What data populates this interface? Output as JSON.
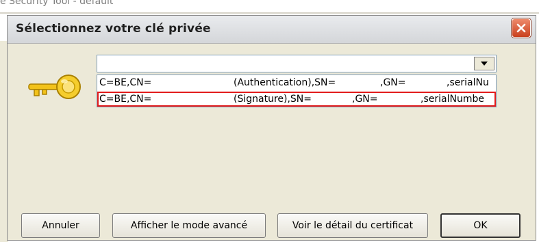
{
  "background": {
    "partial_title": "e Security Tool - default"
  },
  "dialog": {
    "title": "Sélectionnez votre clé privée",
    "close_symbol": "✕",
    "key_icon": "key-icon",
    "combo": {
      "selected_value": ""
    },
    "list_items": [
      {
        "segments": [
          "C=BE,CN=",
          "(Authentication),SN=",
          ",GN=",
          ",serialNu"
        ],
        "selected": false
      },
      {
        "segments": [
          "C=BE,CN=",
          "(Signature),SN=",
          ",GN=",
          ",serialNumbe"
        ],
        "selected": true
      }
    ],
    "buttons": {
      "cancel": "Annuler",
      "advanced": "Afficher le mode avancé",
      "detail": "Voir le détail du certificat",
      "ok": "OK"
    },
    "colors": {
      "close_red": "#d9522c",
      "selection_border": "#e21c1c",
      "key_gold": "#f2c21b"
    }
  }
}
